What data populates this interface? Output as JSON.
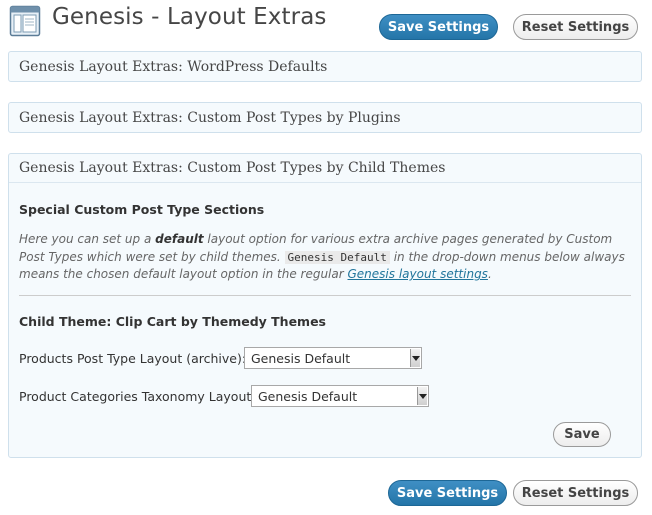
{
  "header": {
    "title": "Genesis - Layout Extras",
    "save_label": "Save Settings",
    "reset_label": "Reset Settings"
  },
  "panels": [
    {
      "title": "Genesis Layout Extras: WordPress Defaults"
    },
    {
      "title": "Genesis Layout Extras: Custom Post Types by Plugins"
    },
    {
      "title": "Genesis Layout Extras: Custom Post Types by Child Themes"
    }
  ],
  "child_themes_panel": {
    "section_heading": "Special Custom Post Type Sections",
    "desc_part1": "Here you can set up a ",
    "desc_bold": "default",
    "desc_part2": " layout option for various extra archive pages generated by Custom Post Types which were set by child themes. ",
    "desc_code": "Genesis Default",
    "desc_part3": " in the drop-down menus below always means the chosen default layout option in the regular ",
    "desc_link": "Genesis layout settings",
    "desc_part4": ".",
    "theme_heading": "Child Theme: Clip Cart by Themedy Themes",
    "fields": [
      {
        "label": "Products Post Type Layout (archive):",
        "value": "Genesis Default"
      },
      {
        "label": "Product Categories Taxonomy Layout:",
        "value": "Genesis Default"
      }
    ],
    "save_label": "Save"
  },
  "footer": {
    "save_label": "Save Settings",
    "reset_label": "Reset Settings"
  },
  "colors": {
    "primary_button": "#2475a8",
    "panel_background": "#f5fafd",
    "panel_border": "#cfe0ec",
    "link": "#21759b"
  }
}
